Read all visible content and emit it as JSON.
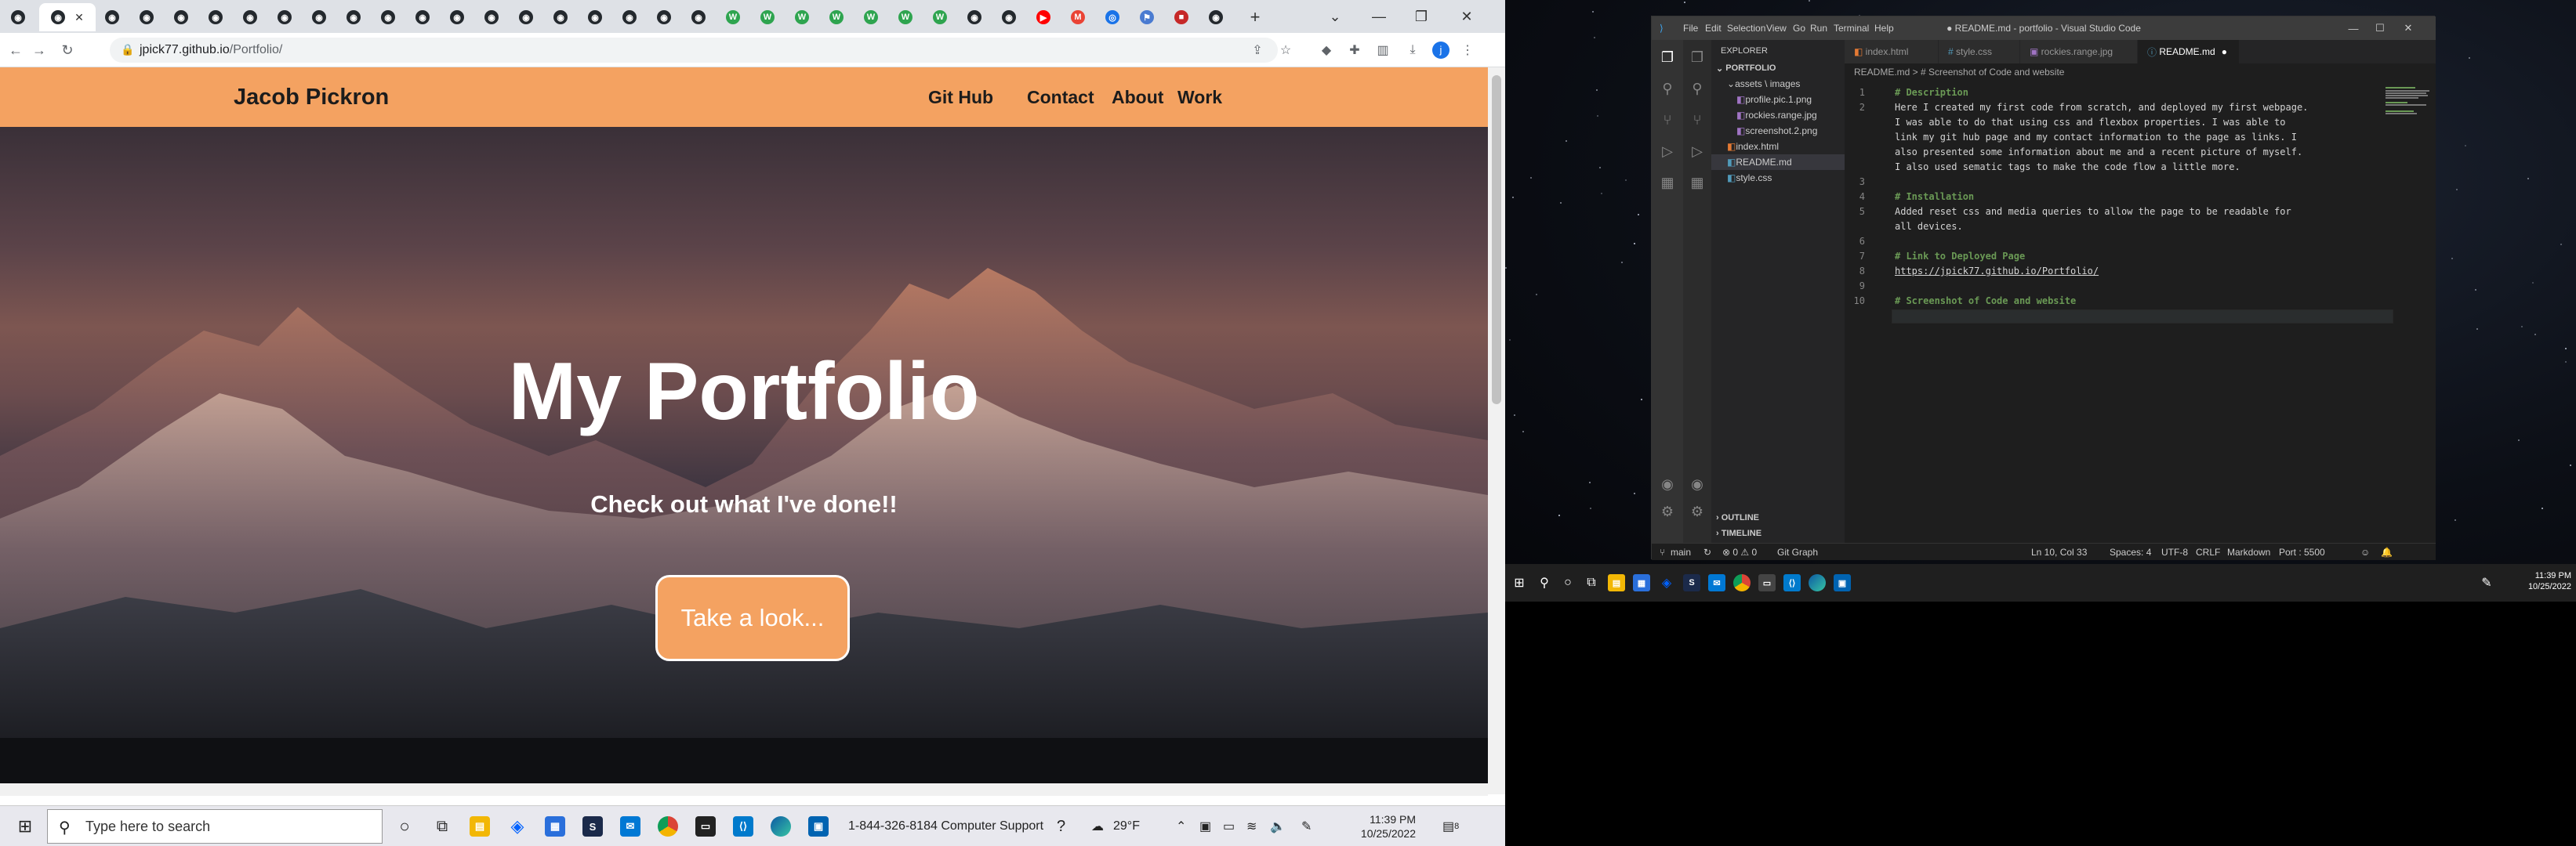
{
  "browser": {
    "url": "jpick77.github.io/Portfolio/",
    "url_host": "jpick77.github.io",
    "url_path": "/Portfolio/",
    "tabs_icons": [
      "github-icon",
      "github-icon",
      "github-icon",
      "github-icon",
      "github-icon",
      "github-icon",
      "github-icon",
      "github-icon",
      "github-icon",
      "github-icon",
      "github-icon",
      "github-icon",
      "github-icon",
      "github-icon",
      "github-icon",
      "github-icon",
      "github-icon",
      "github-icon",
      "github-icon",
      "github-icon",
      "w-icon",
      "w-icon",
      "w-icon",
      "w-icon",
      "w-icon",
      "w-icon",
      "w-icon",
      "github-icon",
      "github-icon",
      "youtube-icon",
      "gmail-icon",
      "chrome-icon",
      "flag-icon",
      "red-icon",
      "github-icon"
    ]
  },
  "site": {
    "brand": "Jacob Pickron",
    "nav": [
      "Git Hub",
      "Contact",
      "About",
      "Work"
    ],
    "hero_title": "My Portfolio",
    "hero_subtitle": "Check out what I've done!!",
    "hero_button": "Take a look..."
  },
  "taskbar1": {
    "search_placeholder": "Type here to search",
    "support_text": "1-844-326-8184 Computer Support",
    "weather": "29°F",
    "time": "11:39 PM",
    "date": "10/25/2022",
    "notification_count": "8"
  },
  "vscode": {
    "title": "● README.md - portfolio - Visual Studio Code",
    "menu": [
      "File",
      "Edit",
      "Selection",
      "View",
      "Go",
      "Run",
      "Terminal",
      "Help"
    ],
    "explorer_label": "EXPLORER",
    "project": "PORTFOLIO",
    "tree": [
      {
        "label": "assets \\ images",
        "indent": 1
      },
      {
        "label": "profile.pic.1.png",
        "indent": 2
      },
      {
        "label": "rockies.range.jpg",
        "indent": 2
      },
      {
        "label": "screenshot.2.png",
        "indent": 2
      },
      {
        "label": "index.html",
        "indent": 1
      },
      {
        "label": "README.md",
        "indent": 1
      },
      {
        "label": "style.css",
        "indent": 1
      }
    ],
    "outline": "OUTLINE",
    "timeline": "TIMELINE",
    "tabs": [
      "index.html",
      "style.css",
      "rockies.range.jpg",
      "README.md"
    ],
    "breadcrumb": "README.md > # Screenshot of Code and website",
    "lines": [
      {
        "n": "1",
        "text": "# Description",
        "kind": "head"
      },
      {
        "n": "2",
        "text": "Here I created my first code from scratch, and deployed my first webpage.",
        "kind": "text"
      },
      {
        "n": "",
        "text": "I was able to do that using css and flexbox properties. I was able to",
        "kind": "text"
      },
      {
        "n": "",
        "text": "link my git hub page and my contact information to the page as links. I",
        "kind": "text"
      },
      {
        "n": "",
        "text": "also presented some information about me and a recent picture of myself.",
        "kind": "text"
      },
      {
        "n": "",
        "text": "I also used sematic tags to make the code flow a little more.",
        "kind": "text"
      },
      {
        "n": "3",
        "text": "",
        "kind": "text"
      },
      {
        "n": "4",
        "text": "# Installation",
        "kind": "head"
      },
      {
        "n": "5",
        "text": "Added reset css and media queries to allow the page to be readable for",
        "kind": "text"
      },
      {
        "n": "",
        "text": "all devices.",
        "kind": "text"
      },
      {
        "n": "6",
        "text": "",
        "kind": "text"
      },
      {
        "n": "7",
        "text": "# Link to Deployed Page",
        "kind": "head"
      },
      {
        "n": "8",
        "text": "https://jpick77.github.io/Portfolio/",
        "kind": "link"
      },
      {
        "n": "9",
        "text": "",
        "kind": "text"
      },
      {
        "n": "10",
        "text": "# Screenshot of Code and website",
        "kind": "head"
      }
    ],
    "status": {
      "branch": "main",
      "problems": "⊗ 0 ⚠ 0",
      "gitgraph": "Git Graph",
      "position": "Ln 10, Col 33",
      "spaces": "Spaces: 4",
      "encoding": "UTF-8",
      "eol": "CRLF",
      "language": "Markdown",
      "port": "Port : 5500"
    }
  },
  "taskbar2": {
    "time": "11:39 PM",
    "date": "10/25/2022"
  }
}
